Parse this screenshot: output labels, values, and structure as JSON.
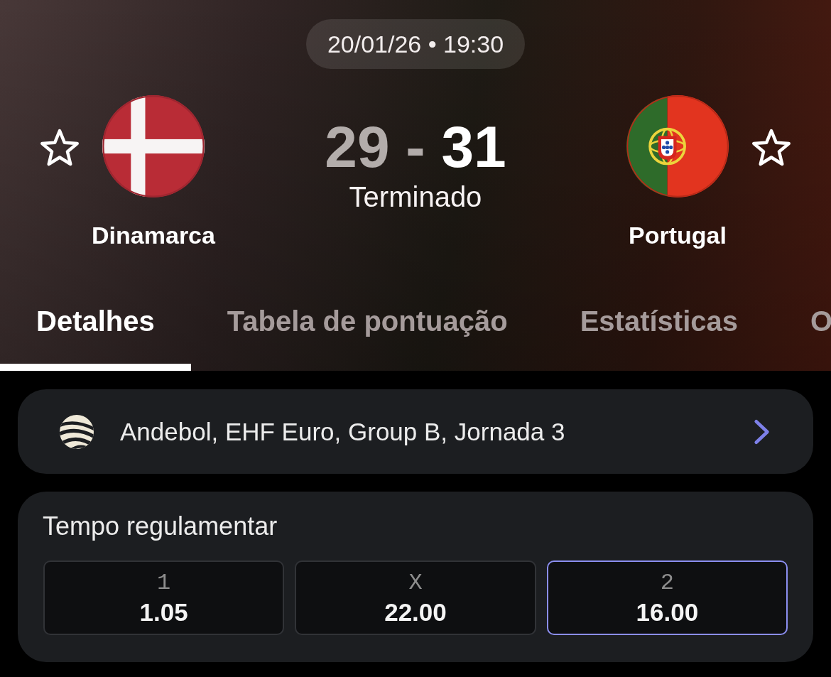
{
  "match": {
    "datetime": "20/01/26 • 19:30",
    "separator": "-",
    "status": "Terminado",
    "teams": [
      {
        "name": "Dinamarca",
        "kind": "denmark",
        "score": "29",
        "winner": false,
        "favorite": false
      },
      {
        "name": "Portugal",
        "kind": "portugal",
        "score": "31",
        "winner": true,
        "favorite": false
      }
    ]
  },
  "tabs": [
    {
      "label": "Detalhes",
      "selected": true
    },
    {
      "label": "Tabela de pontuação",
      "selected": false
    },
    {
      "label": "Estatísticas",
      "selected": false
    },
    {
      "label": "O",
      "selected": false
    }
  ],
  "competition": {
    "label": "Andebol, EHF Euro, Group B, Jornada 3"
  },
  "market": {
    "title": "Tempo regulamentar",
    "odds": [
      {
        "label": "1",
        "value": "1.05",
        "selected": false
      },
      {
        "label": "X",
        "value": "22.00",
        "selected": false
      },
      {
        "label": "2",
        "value": "16.00",
        "selected": true
      }
    ]
  }
}
